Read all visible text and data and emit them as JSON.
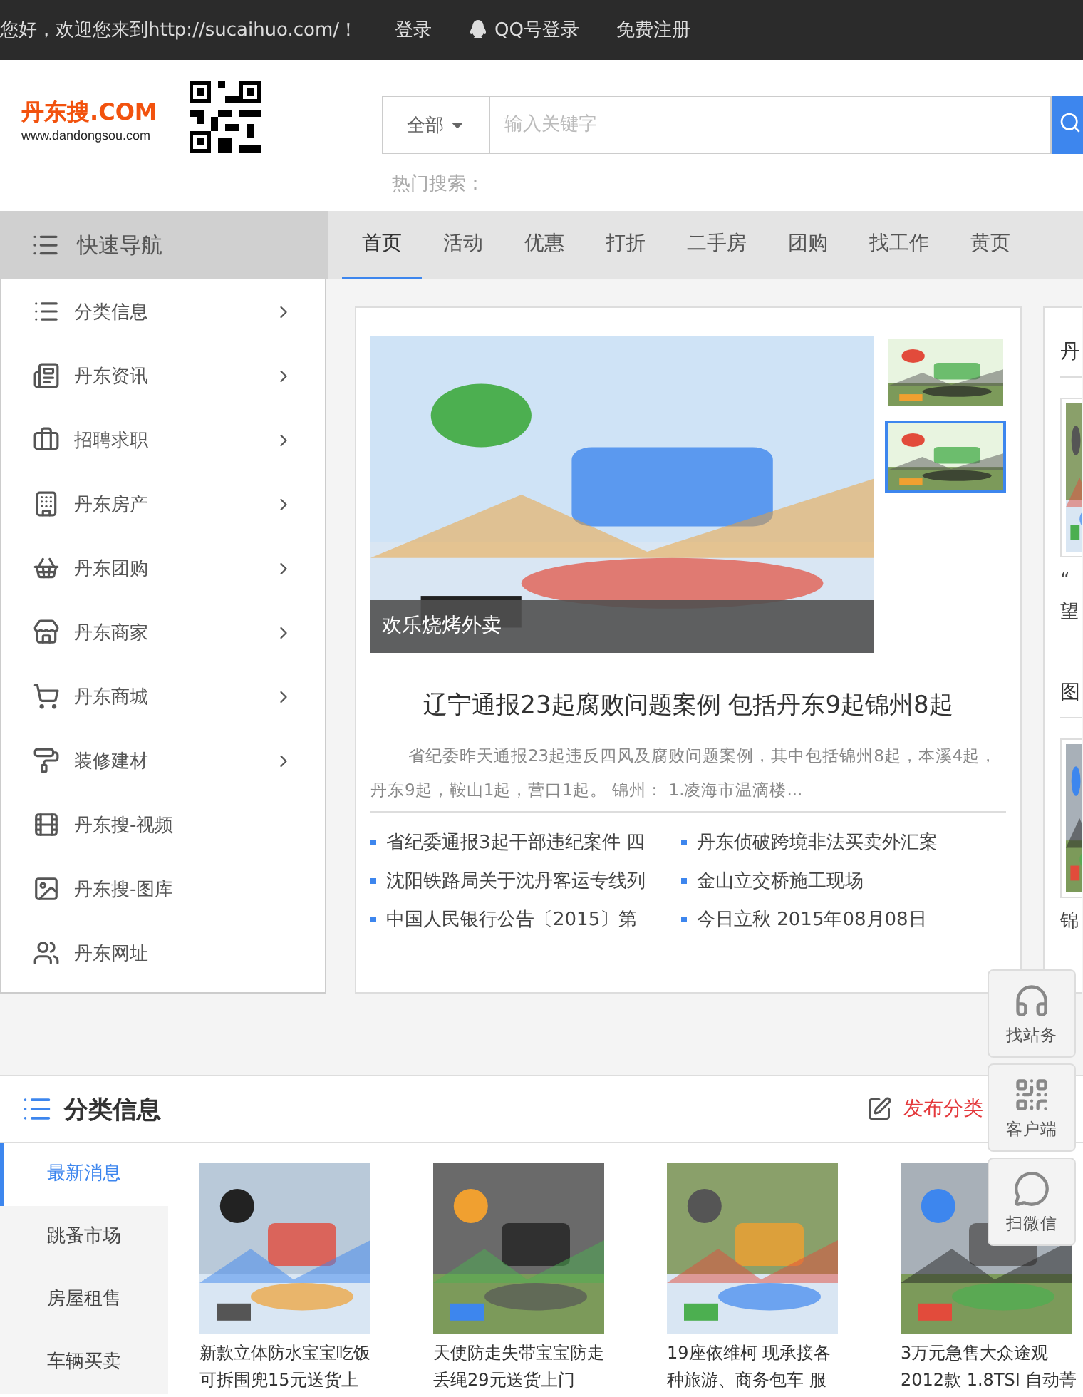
{
  "top_bar": {
    "welcome": "您好，欢迎您来到http://sucaihuo.com/！",
    "links": [
      "登录",
      "QQ号登录",
      "免费注册"
    ]
  },
  "header": {
    "logo": {
      "name": "丹东搜",
      "suffix": ".COM",
      "url": "www.dandongsou.com"
    },
    "search": {
      "scope": "全部",
      "placeholder": "输入关键字"
    },
    "hot_label": "热门搜索："
  },
  "quick_nav": {
    "title": "快速导航",
    "items": [
      {
        "label": "分类信息",
        "has_submenu": true
      },
      {
        "label": "丹东资讯",
        "has_submenu": true
      },
      {
        "label": "招聘求职",
        "has_submenu": true
      },
      {
        "label": "丹东房产",
        "has_submenu": true
      },
      {
        "label": "丹东团购",
        "has_submenu": true
      },
      {
        "label": "丹东商家",
        "has_submenu": true
      },
      {
        "label": "丹东商城",
        "has_submenu": true
      },
      {
        "label": "装修建材",
        "has_submenu": true
      },
      {
        "label": "丹东搜-视频",
        "has_submenu": false
      },
      {
        "label": "丹东搜-图库",
        "has_submenu": false
      },
      {
        "label": "丹东网址",
        "has_submenu": false
      }
    ]
  },
  "tabs": [
    {
      "label": "首页",
      "selected": true
    },
    {
      "label": "活动",
      "selected": false
    },
    {
      "label": "优惠",
      "selected": false
    },
    {
      "label": "打折",
      "selected": false
    },
    {
      "label": "二手房",
      "selected": false
    },
    {
      "label": "团购",
      "selected": false
    },
    {
      "label": "找工作",
      "selected": false
    },
    {
      "label": "黄页",
      "selected": false
    }
  ],
  "slideshow": {
    "caption": "欢乐烧烤外卖",
    "thumbnails": [
      {
        "kind": "picture",
        "selected": false
      },
      {
        "kind": "picture",
        "selected": true
      }
    ]
  },
  "headline": {
    "title": "辽宁通报23起腐败问题案例 包括丹东9起锦州8起",
    "summary": "省纪委昨天通报23起违反四风及腐败问题案例，其中包括锦州8起，本溪4起，丹东9起，鞍山1起，营口1起。 锦州： 1.凌海市温滴楼..."
  },
  "news": [
    "省纪委通报3起干部违纪案件 四",
    "丹东侦破跨境非法买卖外汇案",
    "沈阳铁路局关于沈丹客运专线列",
    "金山立交桥施工现场",
    "中国人民银行公告〔2015〕第",
    "今日立秋 2015年08月08日"
  ],
  "side_panel": {
    "sections": [
      {
        "title": "丹",
        "caption_lines": [
          "“",
          "望"
        ]
      },
      {
        "title": "图",
        "caption_lines": [
          "锦"
        ]
      }
    ]
  },
  "float_buttons": [
    "找站务",
    "客户端",
    "扫微信"
  ],
  "classifieds": {
    "title": "分类信息",
    "post_link": "发布分类",
    "categories": [
      {
        "label": "最新消息",
        "selected": true
      },
      {
        "label": "跳蚤市场",
        "selected": false
      },
      {
        "label": "房屋租售",
        "selected": false
      },
      {
        "label": "车辆买卖",
        "selected": false
      }
    ],
    "listings": [
      {
        "lines": [
          "新款立体防水宝宝吃饭",
          "可拆围兜15元送货上"
        ]
      },
      {
        "lines": [
          "天使防走失带宝宝防走",
          "丢绳29元送货上门"
        ]
      },
      {
        "lines": [
          "19座依维柯 现承接各",
          "种旅游、商务包车 服"
        ]
      },
      {
        "lines": [
          "3万元急售大众途观",
          "2012款 1.8TSI 自动菁"
        ]
      }
    ]
  }
}
